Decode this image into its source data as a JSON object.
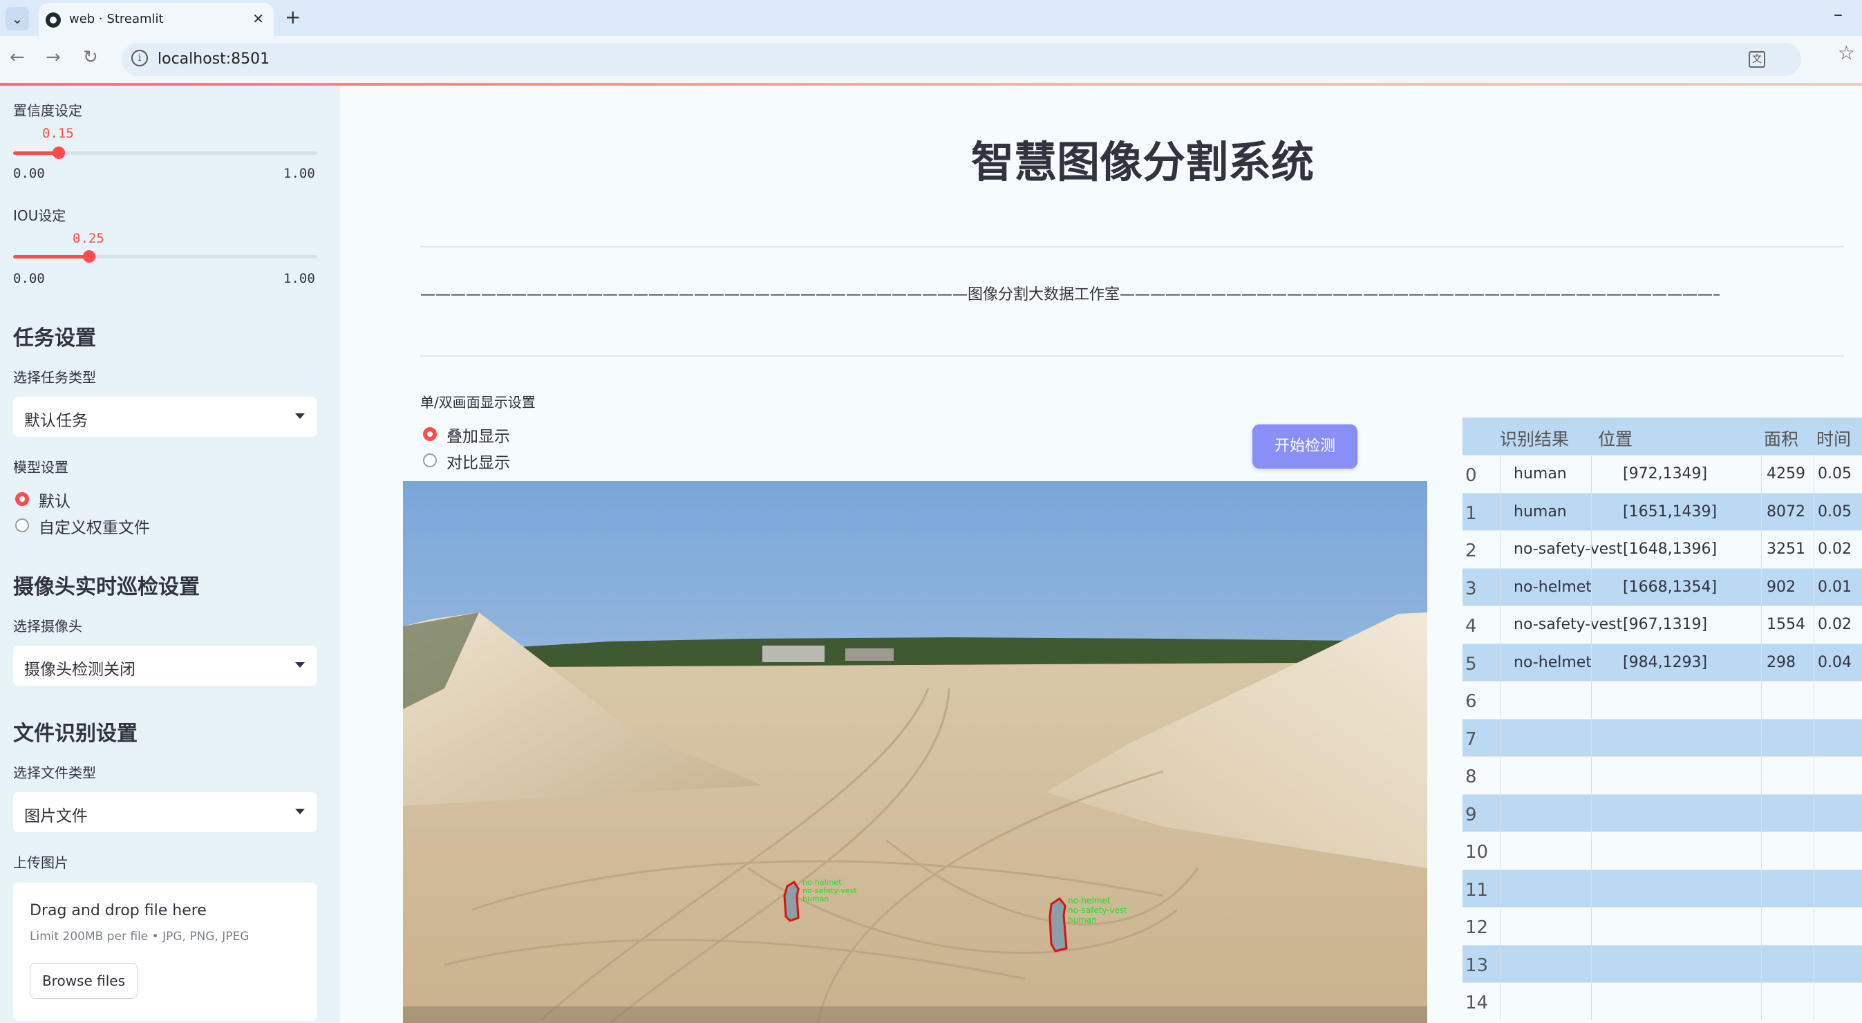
{
  "browser": {
    "tab_title": "web · Streamlit",
    "url": "localhost:8501"
  },
  "sidebar": {
    "confidence": {
      "label": "置信度设定",
      "value": "0.15",
      "min": "0.00",
      "max": "1.00",
      "fraction": 0.15
    },
    "iou": {
      "label": "IOU设定",
      "value": "0.25",
      "min": "0.00",
      "max": "1.00",
      "fraction": 0.25
    },
    "task_header": "任务设置",
    "task_type_label": "选择任务类型",
    "task_type_value": "默认任务",
    "model_label": "模型设置",
    "model_options": [
      "默认",
      "自定义权重文件"
    ],
    "camera_header": "摄像头实时巡检设置",
    "camera_label": "选择摄像头",
    "camera_value": "摄像头检测关闭",
    "file_header": "文件识别设置",
    "file_type_label": "选择文件类型",
    "file_type_value": "图片文件",
    "upload_label": "上传图片",
    "upload_title": "Drag and drop file here",
    "upload_limit": "Limit 200MB per file • JPG, PNG, JPEG",
    "browse_label": "Browse files"
  },
  "main": {
    "title": "智慧图像分割系统",
    "studio_line": "————————————————————————————————————图像分割大数据工作室————————————————————————————————————————",
    "display_label": "单/双画面显示设置",
    "display_options": [
      "叠加显示",
      "对比显示"
    ],
    "start_button": "开始检测",
    "detections": [
      {
        "label": "no-helmet",
        "color": "#22dd22"
      },
      {
        "label": "no-safety-vest",
        "color": "#22dd22"
      },
      {
        "label": "human",
        "color": "#22dd22"
      }
    ]
  },
  "table": {
    "headers": [
      "识别结果",
      "位置",
      "面积",
      "时间"
    ],
    "rows": [
      {
        "idx": "0",
        "label": "human",
        "pos": "[972,1349]",
        "area": "4259",
        "time": "0.05"
      },
      {
        "idx": "1",
        "label": "human",
        "pos": "[1651,1439]",
        "area": "8072",
        "time": "0.05"
      },
      {
        "idx": "2",
        "label": "no-safety-vest",
        "pos": "[1648,1396]",
        "area": "3251",
        "time": "0.02"
      },
      {
        "idx": "3",
        "label": "no-helmet",
        "pos": "[1668,1354]",
        "area": "902",
        "time": "0.01"
      },
      {
        "idx": "4",
        "label": "no-safety-vest",
        "pos": "[967,1319]",
        "area": "1554",
        "time": "0.02"
      },
      {
        "idx": "5",
        "label": "no-helmet",
        "pos": "[984,1293]",
        "area": "298",
        "time": "0.04"
      },
      {
        "idx": "6",
        "label": "",
        "pos": "",
        "area": "",
        "time": ""
      },
      {
        "idx": "7",
        "label": "",
        "pos": "",
        "area": "",
        "time": ""
      },
      {
        "idx": "8",
        "label": "",
        "pos": "",
        "area": "",
        "time": ""
      },
      {
        "idx": "9",
        "label": "",
        "pos": "",
        "area": "",
        "time": ""
      },
      {
        "idx": "10",
        "label": "",
        "pos": "",
        "area": "",
        "time": ""
      },
      {
        "idx": "11",
        "label": "",
        "pos": "",
        "area": "",
        "time": ""
      },
      {
        "idx": "12",
        "label": "",
        "pos": "",
        "area": "",
        "time": ""
      },
      {
        "idx": "13",
        "label": "",
        "pos": "",
        "area": "",
        "time": ""
      },
      {
        "idx": "14",
        "label": "",
        "pos": "",
        "area": "",
        "time": ""
      }
    ]
  }
}
